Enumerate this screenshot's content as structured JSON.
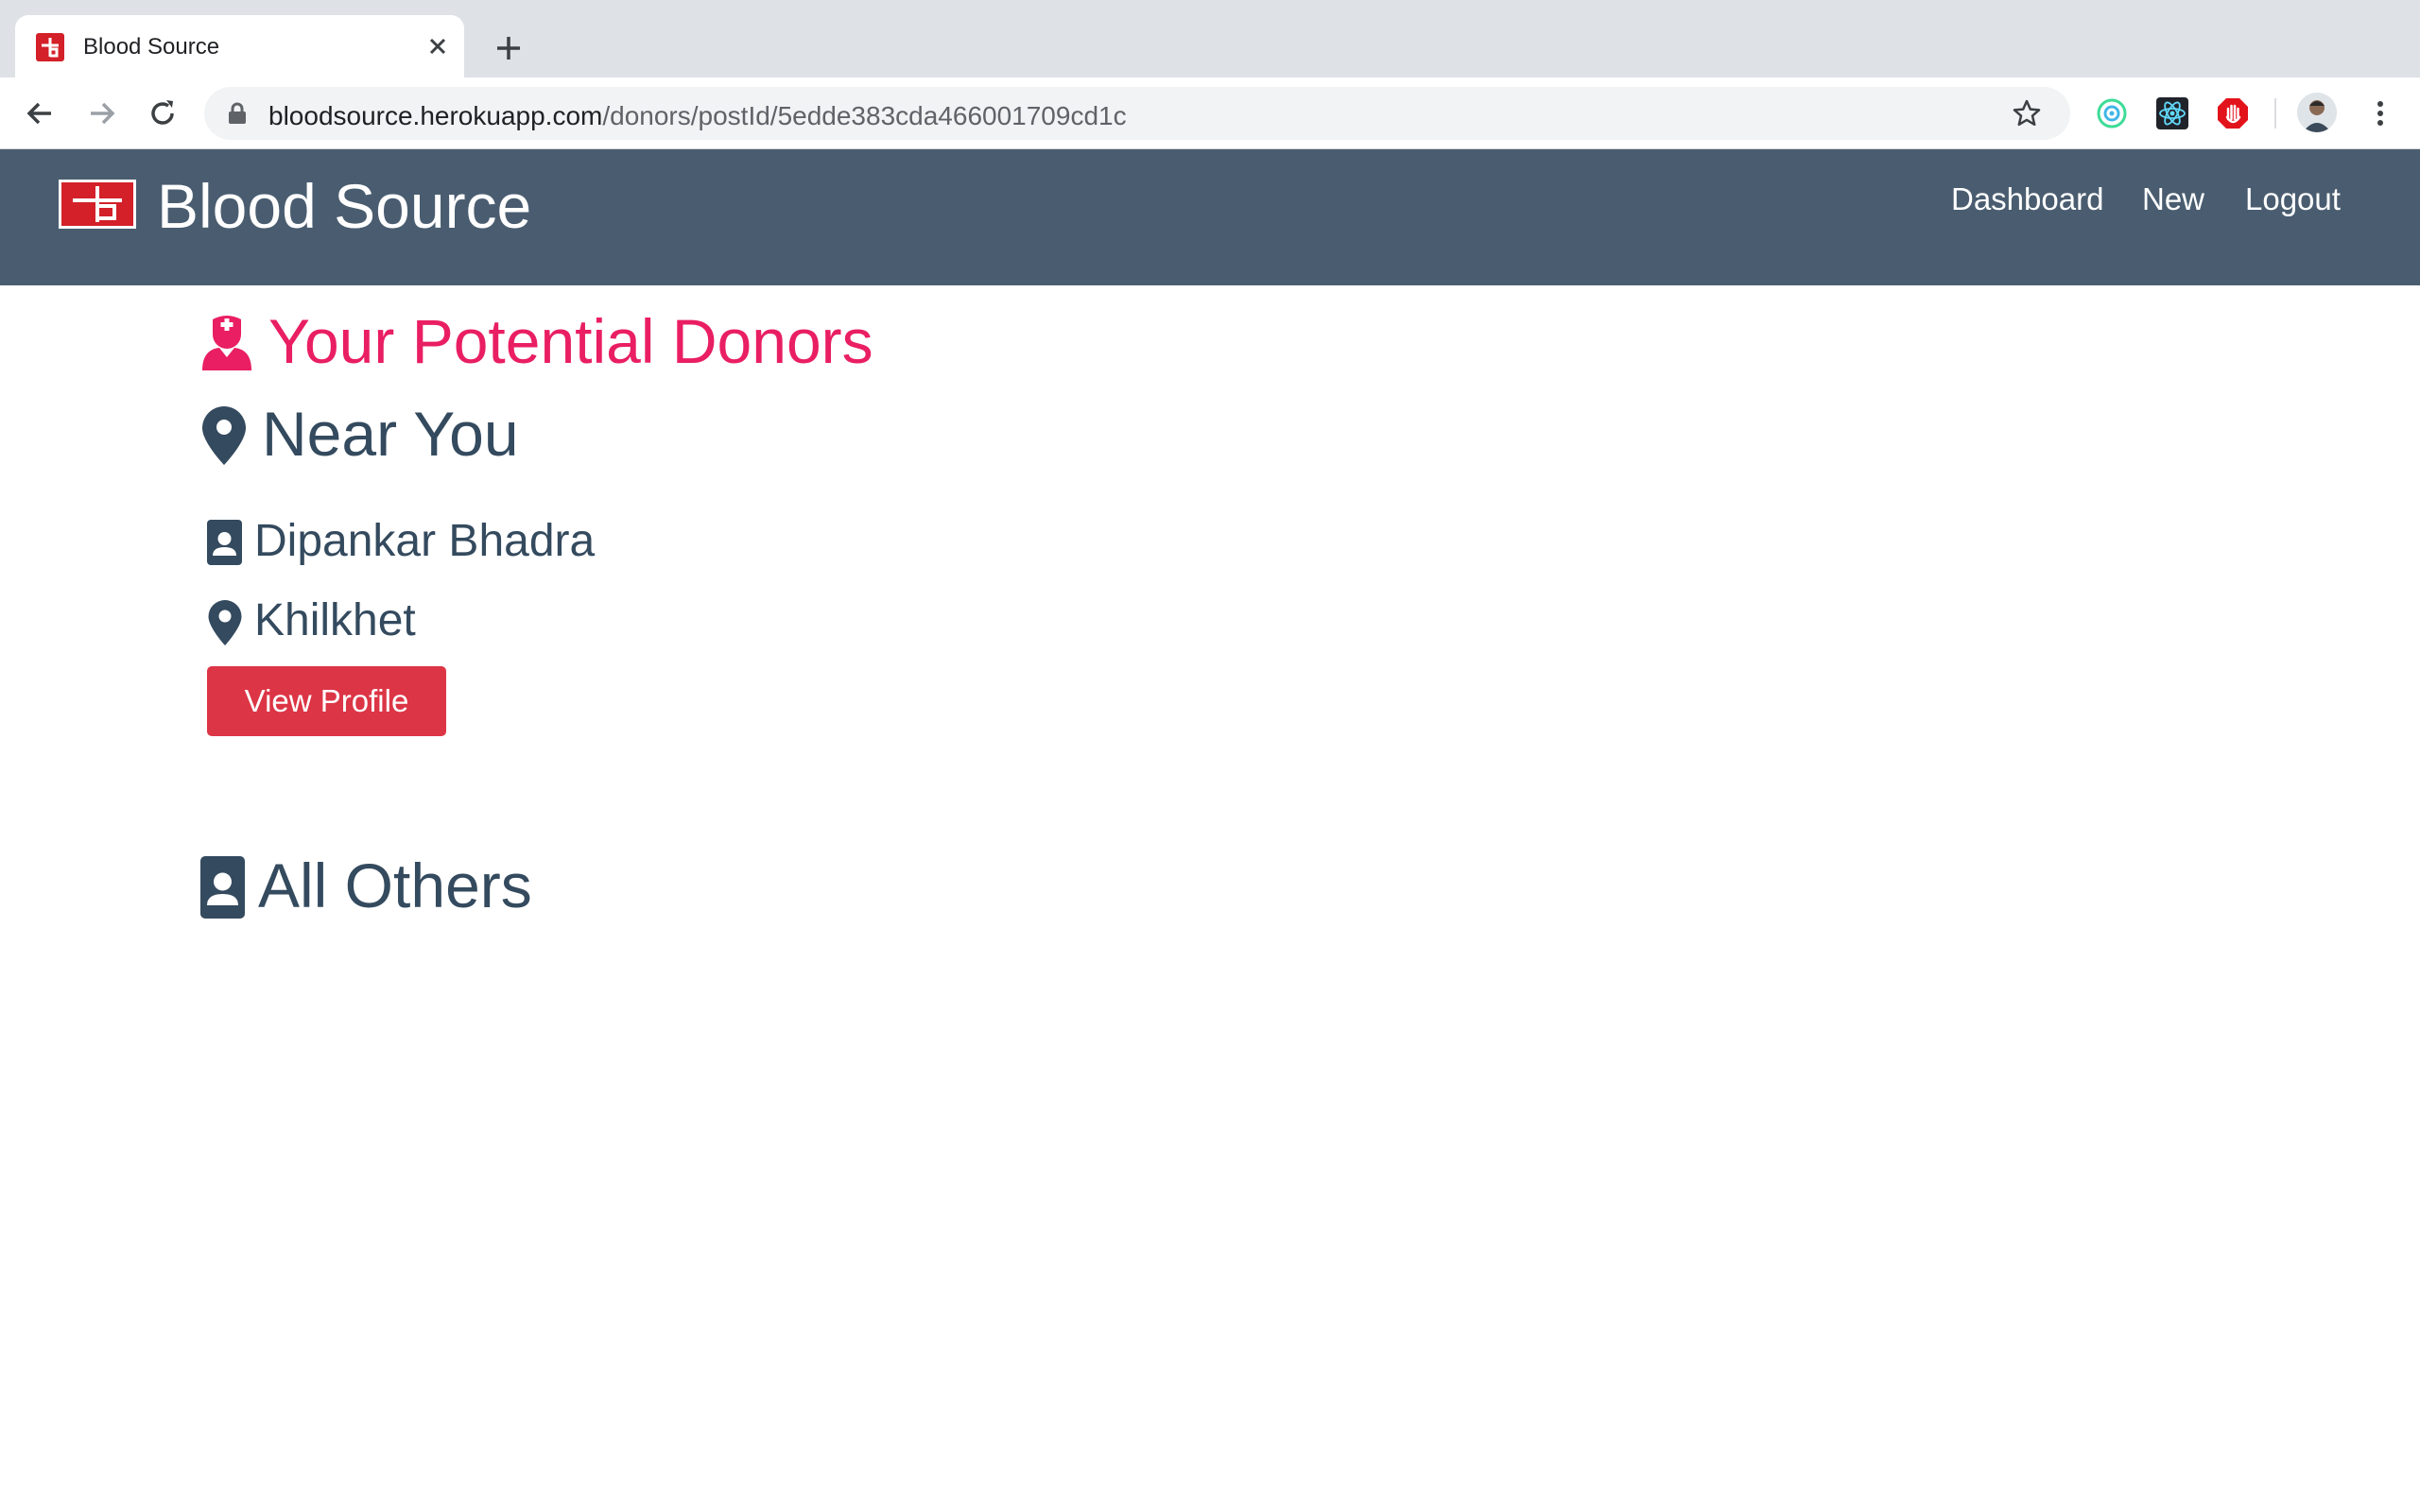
{
  "browser": {
    "tab_title": "Blood Source",
    "url_host": "bloodsource.herokuapp.com",
    "url_path": "/donors/postId/5edde383cda466001709cd1c"
  },
  "navbar": {
    "brand": "Blood Source",
    "links": [
      "Dashboard",
      "New",
      "Logout"
    ]
  },
  "main": {
    "heading": "Your Potential Donors",
    "near_heading": "Near You",
    "donors": [
      {
        "name": "Dipankar Bhadra",
        "location": "Khilkhet",
        "button_label": "View Profile"
      }
    ],
    "others_heading": "All Others"
  },
  "colors": {
    "navbar_bg": "#4a5d70",
    "accent_pink": "#e91e63",
    "button_red": "#dc3545",
    "text_dark": "#344a5e"
  }
}
